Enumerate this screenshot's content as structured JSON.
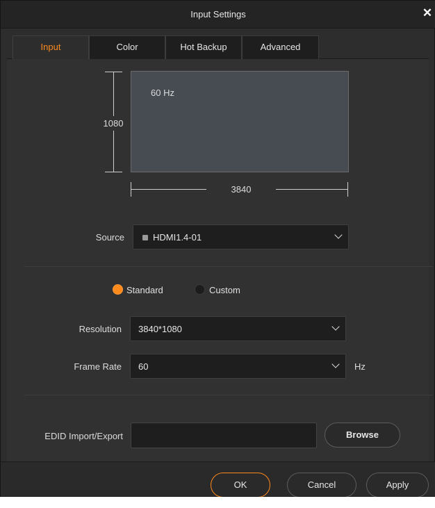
{
  "window": {
    "title": "Input Settings"
  },
  "tabs": [
    {
      "label": "Input",
      "active": true
    },
    {
      "label": "Color",
      "active": false
    },
    {
      "label": "Hot Backup",
      "active": false
    },
    {
      "label": "Advanced",
      "active": false
    }
  ],
  "preview": {
    "frequency": "60 Hz",
    "height": "1080",
    "width": "3840"
  },
  "source": {
    "label": "Source",
    "value": "HDMI1.4-01"
  },
  "mode": {
    "standard_label": "Standard",
    "custom_label": "Custom",
    "selected": "Standard"
  },
  "resolution": {
    "label": "Resolution",
    "value": "3840*1080"
  },
  "frame_rate": {
    "label": "Frame Rate",
    "value": "60",
    "unit": "Hz"
  },
  "edid": {
    "label": "EDID Import/Export",
    "value": "",
    "browse_label": "Browse"
  },
  "footer": {
    "ok_label": "OK",
    "cancel_label": "Cancel",
    "apply_label": "Apply"
  },
  "colors": {
    "accent": "#ff8a1c",
    "background": "#2d2d2d",
    "field": "#1e1e1e"
  }
}
